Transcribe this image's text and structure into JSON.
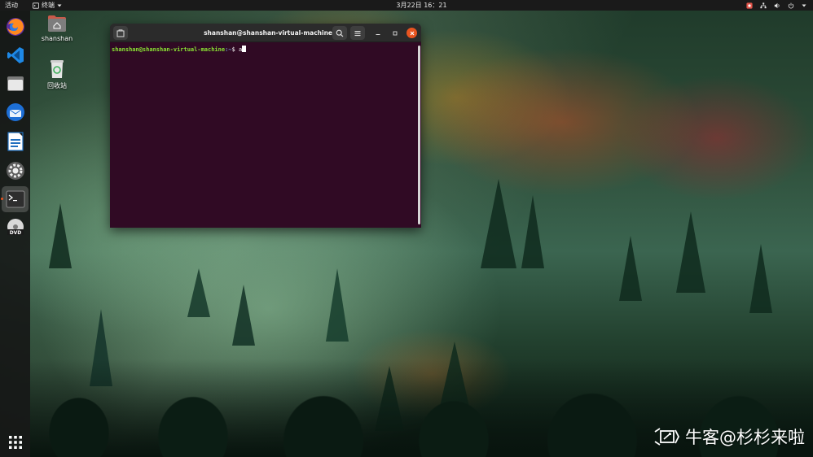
{
  "topbar": {
    "activities": "活动",
    "app_menu": "终端",
    "clock": "3月22日  16：21"
  },
  "dock": {
    "items": [
      {
        "name": "Firefox",
        "icon": "firefox-icon"
      },
      {
        "name": "Visual Studio Code",
        "icon": "vscode-icon"
      },
      {
        "name": "Files",
        "icon": "folder-icon"
      },
      {
        "name": "Thunderbird",
        "icon": "thunderbird-icon"
      },
      {
        "name": "LibreOffice Writer",
        "icon": "writer-icon"
      },
      {
        "name": "Settings",
        "icon": "settings-icon"
      },
      {
        "name": "Terminal",
        "icon": "terminal-icon",
        "active": true
      },
      {
        "name": "DVD",
        "icon": "dvd-icon"
      },
      {
        "name": "Show Applications",
        "icon": "app-grid-icon"
      }
    ]
  },
  "desktop": {
    "icons": [
      {
        "label": "shanshan",
        "icon": "home-folder-icon"
      },
      {
        "label": "回收站",
        "icon": "trash-icon"
      }
    ]
  },
  "terminal": {
    "title": "shanshan@shanshan-virtual-machine: ~",
    "prompt_user": "shanshan@shanshan-virtual-machine",
    "prompt_path": ":~",
    "prompt_symbol": "$ ",
    "input": "a"
  },
  "watermark": {
    "text": "牛客@杉杉来啦"
  },
  "colors": {
    "terminal_bg": "#300a24",
    "close_button": "#e95420",
    "prompt_user": "#8ae234",
    "prompt_path": "#729fcf"
  }
}
